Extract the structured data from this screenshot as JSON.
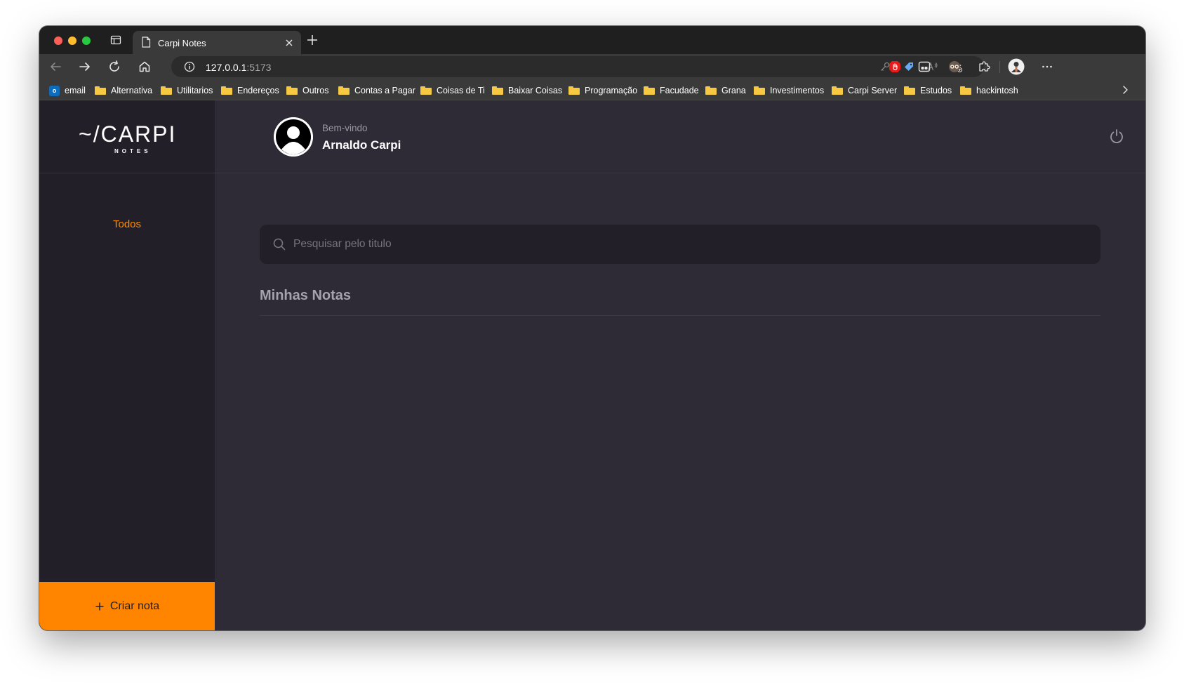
{
  "browser": {
    "tab_title": "Carpi Notes",
    "url_host": "127.0.0.1",
    "url_port": ":5173",
    "bookmarks": [
      {
        "label": "email",
        "icon": "outlook-icon"
      },
      {
        "label": "Alternativa",
        "icon": "folder-icon"
      },
      {
        "label": "Utilitarios",
        "icon": "folder-icon"
      },
      {
        "label": "Endereços",
        "icon": "folder-icon"
      },
      {
        "label": "Outros",
        "icon": "folder-icon"
      },
      {
        "label": "Contas a Pagar",
        "icon": "folder-icon"
      },
      {
        "label": "Coisas de Ti",
        "icon": "folder-icon"
      },
      {
        "label": "Baixar Coisas",
        "icon": "folder-icon"
      },
      {
        "label": "Programação",
        "icon": "folder-icon"
      },
      {
        "label": "Facudade",
        "icon": "folder-icon"
      },
      {
        "label": "Grana",
        "icon": "folder-icon"
      },
      {
        "label": "Investimentos",
        "icon": "folder-icon"
      },
      {
        "label": "Carpi Server",
        "icon": "folder-icon"
      },
      {
        "label": "Estudos",
        "icon": "folder-icon"
      },
      {
        "label": "hackintosh",
        "icon": "folder-icon"
      }
    ],
    "outlook_letter": "o"
  },
  "app": {
    "logo_main": "~/CARPI",
    "logo_sub": "NOTES",
    "nav": {
      "todos": "Todos"
    },
    "create_button_label": "Criar nota",
    "header": {
      "welcome": "Bem-vindo",
      "username": "Arnaldo Carpi"
    },
    "search": {
      "placeholder": "Pesquisar pelo titulo",
      "value": ""
    },
    "section_title": "Minhas Notas"
  },
  "colors": {
    "accent": "#ff8400",
    "sidebar_bg": "#221f29",
    "main_bg": "#2f2b36"
  }
}
